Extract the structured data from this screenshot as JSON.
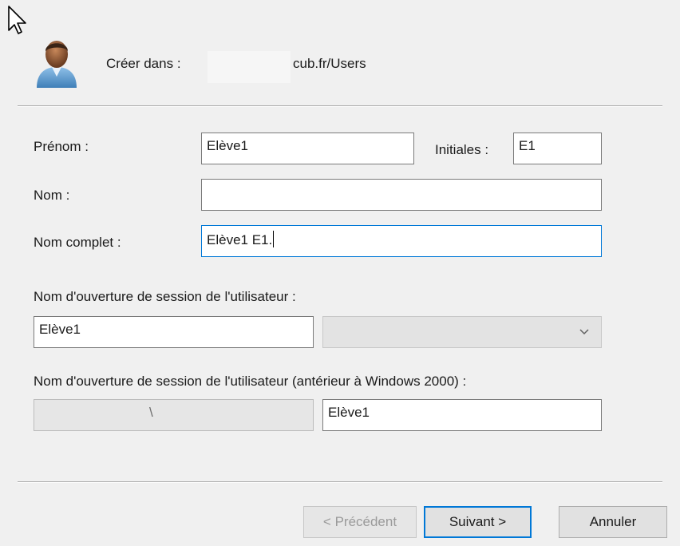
{
  "header": {
    "create_label": "Créer dans :",
    "create_path": "cub.fr/Users"
  },
  "form": {
    "first_name_label": "Prénom :",
    "first_name_value": "Elève1",
    "initials_label": "Initiales :",
    "initials_value": "E1",
    "last_name_label": "Nom :",
    "last_name_value": "",
    "full_name_label": "Nom complet :",
    "full_name_value": "Elève1 E1.",
    "logon_name_label": "Nom d'ouverture de session de l'utilisateur :",
    "logon_name_value": "Elève1",
    "domain_select_value": "",
    "pre2000_label": "Nom d'ouverture de session de l'utilisateur (antérieur à Windows 2000) :",
    "pre2000_domain_value": "\\",
    "pre2000_name_value": "Elève1"
  },
  "buttons": {
    "previous": "< Précédent",
    "next": "Suivant >",
    "cancel": "Annuler"
  },
  "icons": {
    "cursor": "mouse-pointer-icon",
    "avatar": "user-icon",
    "dropdown": "chevron-down-icon"
  },
  "colors": {
    "background": "#f0f0f0",
    "focus_border": "#0078d7"
  }
}
